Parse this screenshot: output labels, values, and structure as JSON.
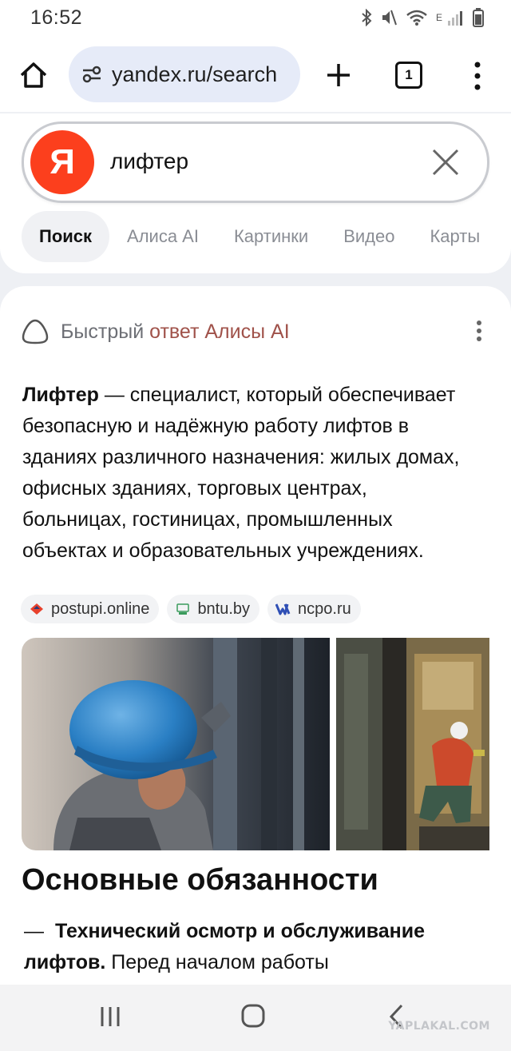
{
  "status_bar": {
    "time": "16:52",
    "icons": [
      "bluetooth-icon",
      "mute-icon",
      "wifi-icon",
      "signal-icon",
      "battery-icon"
    ],
    "network_type": "E"
  },
  "browser": {
    "url": "yandex.ru/search",
    "tab_count": "1",
    "icons": [
      "home-icon",
      "site-settings-icon",
      "plus-icon",
      "tabs-icon",
      "menu-icon"
    ]
  },
  "search": {
    "logo_letter": "Я",
    "query": "лифтер",
    "tabs": [
      {
        "label": "Поиск",
        "active": true
      },
      {
        "label": "Алиса AI",
        "active": false
      },
      {
        "label": "Картинки",
        "active": false
      },
      {
        "label": "Видео",
        "active": false
      },
      {
        "label": "Карты",
        "active": false
      }
    ]
  },
  "answer": {
    "header_prefix": "Быстрый ",
    "header_accent": "ответ Алисы AI",
    "term": "Лифтер",
    "text": " — специалист, который обеспечивает безопасную и надёжную работу лифтов в зданиях различного назначения: жилых домах, офисных зданиях, торговых центрах, больницах, гостиницах, промышленных объектах и образовательных учреждениях.",
    "sources": [
      {
        "label": "postupi.online",
        "icon": "postupi-icon",
        "color": "#e8412c"
      },
      {
        "label": "bntu.by",
        "icon": "bntu-icon",
        "color": "#3a9b5c"
      },
      {
        "label": "ncpo.ru",
        "icon": "ncpo-icon",
        "color": "#2f4fb5"
      }
    ],
    "images": [
      "worker-in-blue-helmet-photo",
      "elevator-repair-photo"
    ]
  },
  "section": {
    "title": "Основные обязанности",
    "item_bold": "Технический осмотр и обслуживание лифтов.",
    "item_text": " Перед началом работы"
  },
  "watermark": "YAPLAKAL.COM",
  "colors": {
    "yandex_red": "#fc3f1d",
    "url_pill": "#e6ebf8",
    "accent_text": "#a0524a"
  }
}
